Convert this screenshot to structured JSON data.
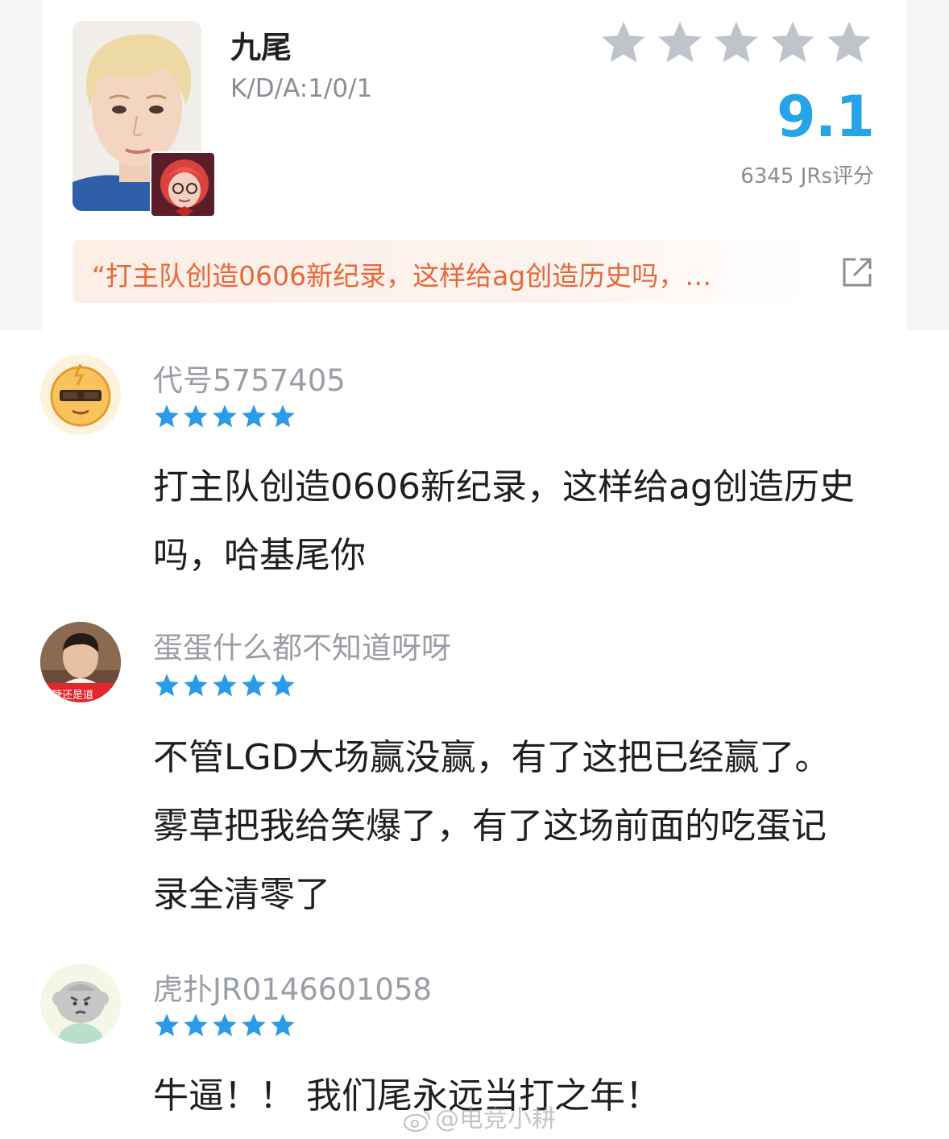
{
  "player": {
    "name": "九尾",
    "kda": "K/D/A:1/0/1",
    "score": "9.1",
    "rating_count": "6345 JRs评分",
    "stars_total": 5,
    "quote": "“打主队创造0606新纪录，这样给ag创造历史吗，…",
    "star_color": "#bfc3ca",
    "score_color": "#27a4e8",
    "quote_color": "#e8683a"
  },
  "comments": [
    {
      "name": "代号5757405",
      "stars": 5,
      "lines": [
        "打主队创造0606新纪录，这样给ag创造历史",
        "吗，哈基尾你"
      ]
    },
    {
      "name": "蛋蛋什么都不知道呀呀",
      "stars": 5,
      "avatar_caption": "糖还是道",
      "lines": [
        "不管LGD大场赢没赢，有了这把已经赢了。",
        "雾草把我给笑爆了，有了这场前面的吃蛋记",
        "录全清零了"
      ]
    },
    {
      "name": "虎扑JR0146601058",
      "stars": 5,
      "lines": [
        "牛逼！！ 我们尾永远当打之年！"
      ]
    }
  ],
  "comment_star_color": "#2a9be8",
  "watermark": "@电竞小耕"
}
